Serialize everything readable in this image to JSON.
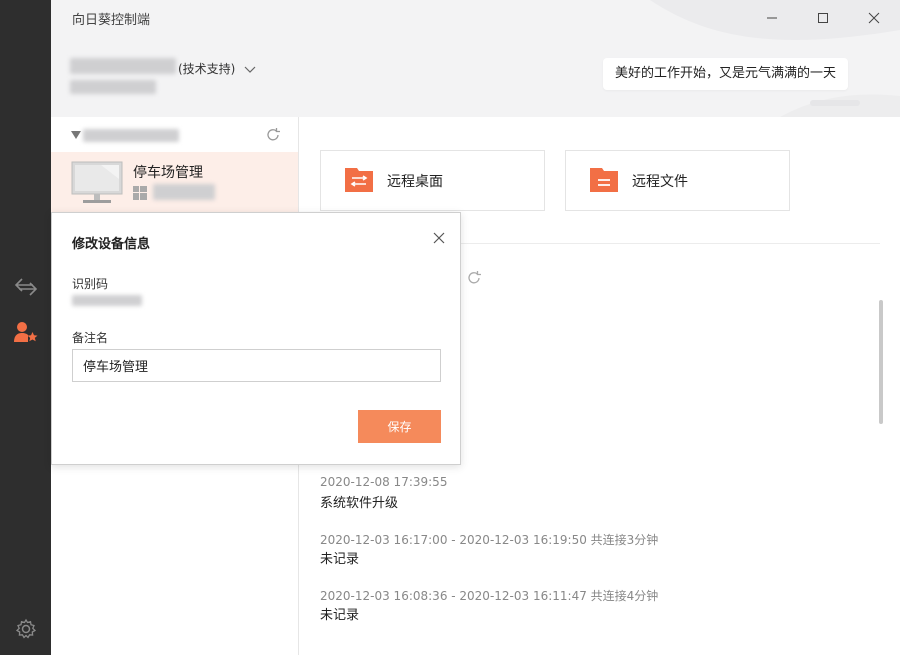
{
  "app": {
    "title": "向日葵控制端"
  },
  "account": {
    "role_label": "(技术支持)",
    "greeting": "美好的工作开始，又是元气满满的一天"
  },
  "device_list": {
    "selected_device_name": "停车场管理"
  },
  "actions": [
    {
      "label": "远程桌面"
    },
    {
      "label": "远程文件"
    }
  ],
  "records": [
    {
      "time": "2020-12-08 17:39:55",
      "text": "系统软件升级"
    },
    {
      "time": "2020-12-03 16:17:00 - 2020-12-03 16:19:50 共连接3分钟",
      "text": "未记录"
    },
    {
      "time": "2020-12-03 16:08:36 - 2020-12-03 16:11:47 共连接4分钟",
      "text": "未记录"
    }
  ],
  "dialog": {
    "title": "修改设备信息",
    "id_label": "识别码",
    "remark_label": "备注名",
    "remark_value": "停车场管理",
    "save_label": "保存"
  },
  "colors": {
    "accent": "#f58a5b",
    "rail": "#2e2e2e",
    "selected_bg": "#fdeee8",
    "icon_orange": "#f26f45"
  },
  "icons": [
    "switch-arrows-icon",
    "contacts-star-icon",
    "settings-gear-icon",
    "refresh-icon",
    "minimize-icon",
    "maximize-icon",
    "close-icon",
    "chevron-down-icon",
    "remote-desktop-icon",
    "remote-file-icon",
    "monitor-icon",
    "windows-logo-icon"
  ]
}
